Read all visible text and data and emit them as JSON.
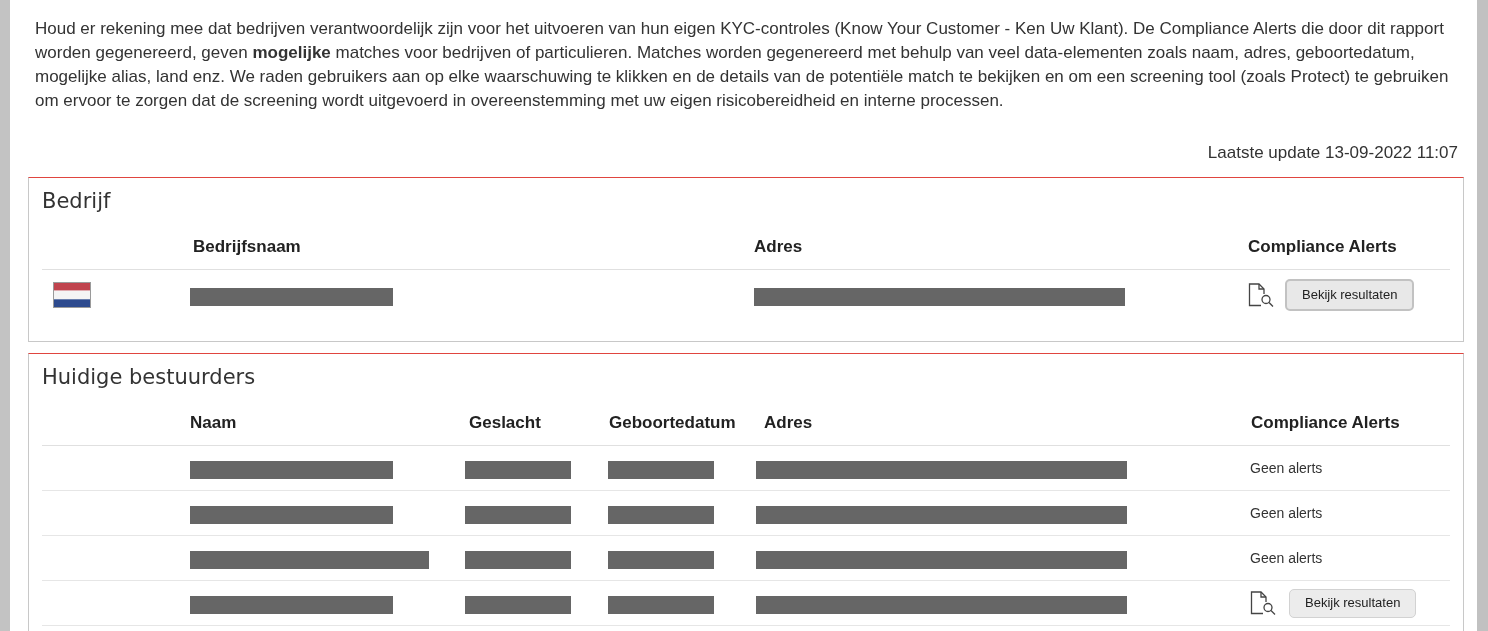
{
  "notice": {
    "text": "Houd er rekening mee dat bedrijven verantwoordelijk zijn voor het uitvoeren van hun eigen KYC-controles (Know Your Customer - Ken Uw Klant). De Compliance Alerts die door dit rapport worden gegenereerd, geven **mogelijke** matches voor bedrijven of particulieren. Matches worden gegenereerd met behulp van veel data-elementen zoals naam, adres, geboortedatum, mogelijke alias, land enz. We raden gebruikers aan op elke waarschuwing te klikken en de details van de potentiële match te bekijken en om een screening tool (zoals Protect) te gebruiken om ervoor te zorgen dat de screening wordt uitgevoerd in overeenstemming met uw eigen risicobereidheid en interne processen."
  },
  "last_update": "Laatste update 13-09-2022 11:07",
  "company": {
    "title": "Bedrijf",
    "columns": [
      "Bedrijfsnaam",
      "Adres",
      "Compliance Alerts"
    ],
    "rows": [
      {
        "alerts": {
          "kind": "results",
          "button": "Bekijk resultaten",
          "focused": true
        }
      }
    ]
  },
  "directors": {
    "title": "Huidige bestuurders",
    "columns": [
      "Naam",
      "Geslacht",
      "Geboortedatum",
      "Adres",
      "Compliance Alerts"
    ],
    "rows": [
      {
        "alerts": {
          "kind": "none",
          "text": "Geen alerts"
        }
      },
      {
        "alerts": {
          "kind": "none",
          "text": "Geen alerts"
        }
      },
      {
        "alerts": {
          "kind": "none",
          "text": "Geen alerts"
        }
      },
      {
        "alerts": {
          "kind": "results",
          "button": "Bekijk resultaten",
          "focused": false
        }
      }
    ]
  }
}
